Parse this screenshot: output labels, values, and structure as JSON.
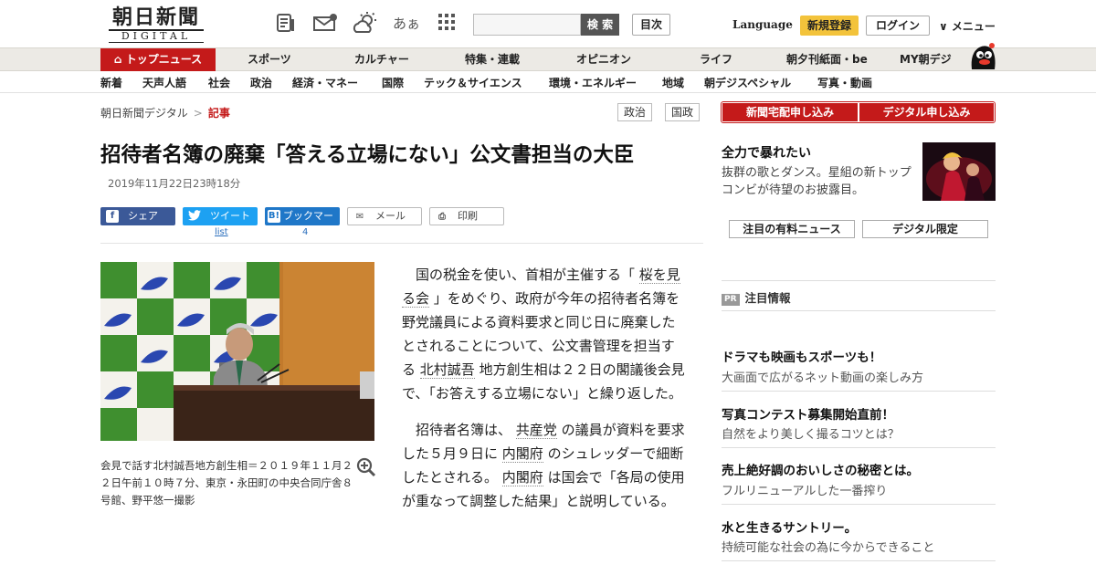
{
  "header": {
    "logo_kanji": "朝日新聞",
    "logo_latin": "DIGITAL",
    "search_button": "検 索",
    "index_button": "目次",
    "language": "Language",
    "register": "新規登録",
    "login": "ログイン",
    "menu": "∨ メニュー",
    "font_size_icon_text": "あぁ"
  },
  "nav_primary": [
    {
      "label": "トップニュース"
    },
    {
      "label": "スポーツ"
    },
    {
      "label": "カルチャー"
    },
    {
      "label": "特集・連載"
    },
    {
      "label": "オピニオン"
    },
    {
      "label": "ライフ"
    },
    {
      "label": "朝夕刊紙面・be"
    },
    {
      "label": "MY朝デジ"
    }
  ],
  "nav_secondary": [
    {
      "label": "新着"
    },
    {
      "label": "天声人語"
    },
    {
      "label": "社会"
    },
    {
      "label": "政治"
    },
    {
      "label": "経済・マネー"
    },
    {
      "label": "国際"
    },
    {
      "label": "テック＆サイエンス"
    },
    {
      "label": "環境・エネルギー"
    },
    {
      "label": "地域"
    },
    {
      "label": "朝デジスペシャル"
    },
    {
      "label": "写真・動画"
    }
  ],
  "breadcrumb": {
    "root": "朝日新聞デジタル",
    "sep": ">",
    "current": "記事"
  },
  "tags": [
    "政治",
    "国政"
  ],
  "article": {
    "title": "招待者名簿の廃棄「答える立場にない」公文書担当の大臣",
    "date": "2019年11月22日23時18分",
    "caption": "会見で話す北村誠吾地方創生相＝２０１９年１１月２２日午前１０時７分、東京・永田町の中央合同庁舎８号館、野平悠一撮影",
    "p1_a": "国の税金を使い、首相が主催する「 ",
    "p1_link1": "桜を見る会",
    "p1_b": " 」をめぐり、政府が今年の招待者名簿を野党議員による資料要求と同じ日に廃棄したとされることについて、公文書管理を担当する ",
    "p1_link2": "北村誠吾",
    "p1_c": " 地方創生相は２２日の閣議後会見で、「お答えする立場にない」と繰り返した。",
    "p2_a": "招待者名簿は、 ",
    "p2_link1": "共産党",
    "p2_b": " の議員が資料を要求した５月９日に ",
    "p2_link2": "内閣府",
    "p2_c": " のシュレッダーで細断したとされる。 ",
    "p2_link3": "内閣府",
    "p2_d": " は国会で「各局の使用が重なって調整した結果」と説明している。"
  },
  "share": {
    "facebook": "シェア",
    "twitter": "ツイート",
    "hatena": "ブックマーク",
    "mail": "メール",
    "print": "印刷",
    "twitter_count": "list",
    "hatena_count": "4"
  },
  "sidebar": {
    "btn_newspaper": "新聞宅配申し込み",
    "btn_digital": "デジタル申し込み",
    "promo_title": "全力で暴れたい",
    "promo_text": "抜群の歌とダンス。星組の新トップコンビが待望のお披露目。",
    "btn_paid_news": "注目の有料ニュース",
    "btn_digital_only": "デジタル限定",
    "pr_badge": "PR",
    "pr_label": "注目情報",
    "ads": [
      {
        "title": "ドラマも映画もスポーツも！",
        "sub": "大画面で広がるネット動画の楽しみ方"
      },
      {
        "title": "写真コンテスト募集開始直前！",
        "sub": "自然をより美しく撮るコツとは？"
      },
      {
        "title": "売上絶好調のおいしさの秘密とは。",
        "sub": "フルリニューアルした一番搾り"
      },
      {
        "title": "水と生きるサントリー。",
        "sub": "持続可能な社会の為に今からできること"
      }
    ]
  },
  "colors": {
    "brand_red": "#c41a1a",
    "register_yellow": "#f3c33b",
    "facebook": "#3b5998",
    "twitter": "#1da1f2",
    "hatena": "#1f77c8"
  }
}
